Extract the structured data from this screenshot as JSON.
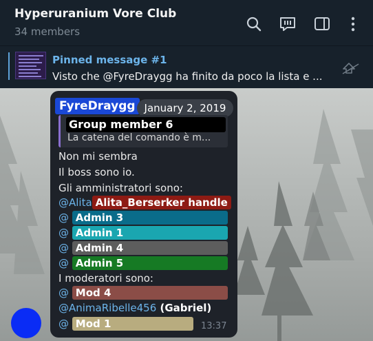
{
  "header": {
    "title": "Hyperuranium Vore Club",
    "subtitle": "34 members"
  },
  "pinned": {
    "label": "Pinned message #1",
    "text": "Visto che @FyreDraygg ha finito da poco la lista e ..."
  },
  "message": {
    "sender": "FyreDraygg",
    "date": "January 2, 2019",
    "reply_name": "Group member 6",
    "reply_text": "La catena del comando è m...",
    "lines": {
      "l1": "Non mi sembra",
      "l2": "Il boss sono io.",
      "l3": "Gli amministratori sono:",
      "at_alita": "@Alita",
      "tag_alita": "Alita_Berserker handle",
      "at": "@",
      "tag_admin3": "Admin 3",
      "tag_admin1": "Admin 1",
      "tag_admin4": "Admin 4",
      "tag_admin5": "Admin 5",
      "l4": "I moderatori sono:",
      "tag_mod4": "Mod 4",
      "at_anima": "@AnimaRibelle456",
      "gabriel": " (Gabriel)",
      "tag_mod1": "Mod 1"
    },
    "time": "13:37"
  },
  "colors": {
    "alita": "#8e1b14",
    "admin3": "#0a6c8a",
    "admin1": "#1aa6b0",
    "admin4": "#5d5d5d",
    "admin5": "#167a24",
    "mod4": "#8b4d47",
    "mod1": "#b8ac7f"
  },
  "icons": [
    "search-icon",
    "discussion-icon",
    "sidebar-toggle-icon",
    "more-vertical-icon",
    "unpin-icon"
  ]
}
